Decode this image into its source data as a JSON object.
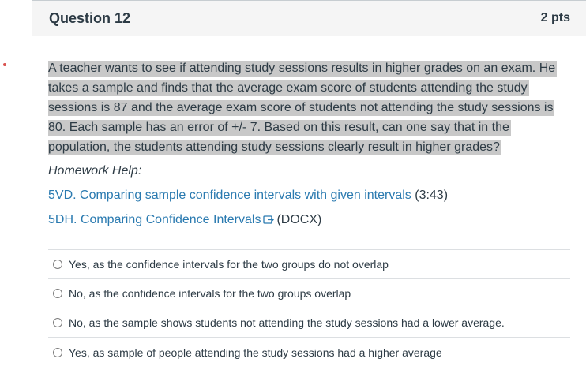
{
  "question": {
    "title": "Question 12",
    "points": "2 pts",
    "text": "A teacher wants to see if attending study sessions results in higher grades on an exam.  He takes a sample and finds that the average exam score of students attending the study sessions is 87 and the average exam score of students not attending the study sessions is 80. Each sample has an error of +/- 7.  Based on this result, can one say that in the population, the students attending study sessions clearly result in higher grades?",
    "help_label": "Homework Help:",
    "links": [
      {
        "text": "5VD. Comparing sample confidence intervals with given intervals",
        "suffix": "(3:43)"
      },
      {
        "text": "5DH. Comparing Confidence Intervals",
        "suffix": "(DOCX)",
        "icon": "external-link-icon"
      }
    ],
    "answers": [
      "Yes, as the confidence intervals for the two groups do not overlap",
      "No, as the confidence intervals for the two groups overlap",
      "No, as the sample shows students not attending the study sessions had a lower average.",
      "Yes, as sample of people attending the study sessions had a higher average"
    ]
  },
  "colors": {
    "link": "#2a7ab0",
    "highlight": "#c8c8c8",
    "header_bg": "#f5f5f5",
    "marker": "#d9534f"
  }
}
